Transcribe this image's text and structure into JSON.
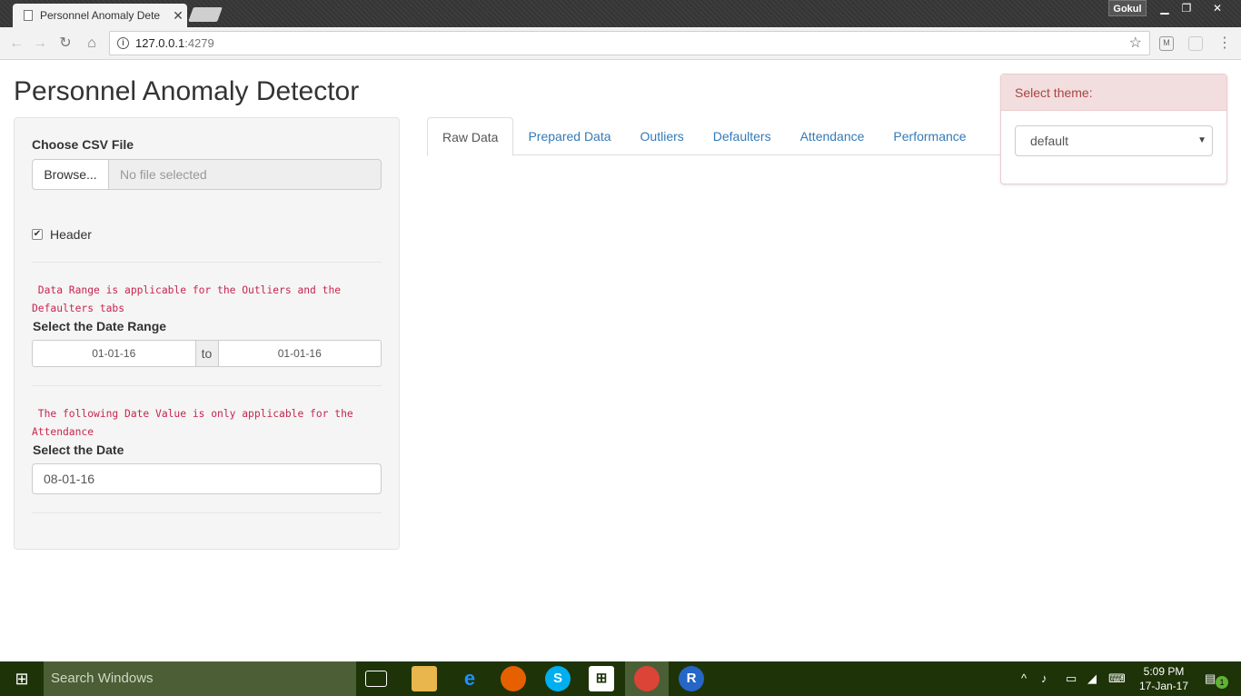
{
  "browser": {
    "tab_title": "Personnel Anomaly Dete",
    "tab_close": "✕",
    "profile_name": "Gokul",
    "url_host": "127.0.0.1",
    "url_port": ":4279"
  },
  "app": {
    "title": "Personnel Anomaly Detector"
  },
  "sidebar": {
    "file_label": "Choose CSV File",
    "browse_label": "Browse...",
    "file_placeholder": "No file selected",
    "header_checkbox_label": "Header",
    "header_checked": true,
    "range_note_line1": " Data Range is applicable for the Outliers and the",
    "range_note_line2": "Defaulters tabs",
    "range_label": "Select the Date Range",
    "range_start": "01-01-16",
    "range_sep": "to",
    "range_end": "01-01-16",
    "date_note_line1": " The following Date Value is only applicable for the",
    "date_note_line2": "Attendance",
    "date_label": "Select the Date",
    "date_value": "08-01-16"
  },
  "tabs": [
    {
      "label": "Raw Data",
      "active": true
    },
    {
      "label": "Prepared Data",
      "active": false
    },
    {
      "label": "Outliers",
      "active": false
    },
    {
      "label": "Defaulters",
      "active": false
    },
    {
      "label": "Attendance",
      "active": false
    },
    {
      "label": "Performance",
      "active": false
    }
  ],
  "theme": {
    "heading": "Select theme:",
    "selected": "default"
  },
  "taskbar": {
    "search_placeholder": "Search Windows",
    "time": "5:09 PM",
    "date": "17-Jan-17",
    "notification_count": "1"
  },
  "colors": {
    "link": "#337ab7",
    "code": "#c7254e",
    "theme_header_bg": "#f2dede",
    "theme_header_text": "#a94442",
    "taskbar_bg": "#1e3308"
  }
}
